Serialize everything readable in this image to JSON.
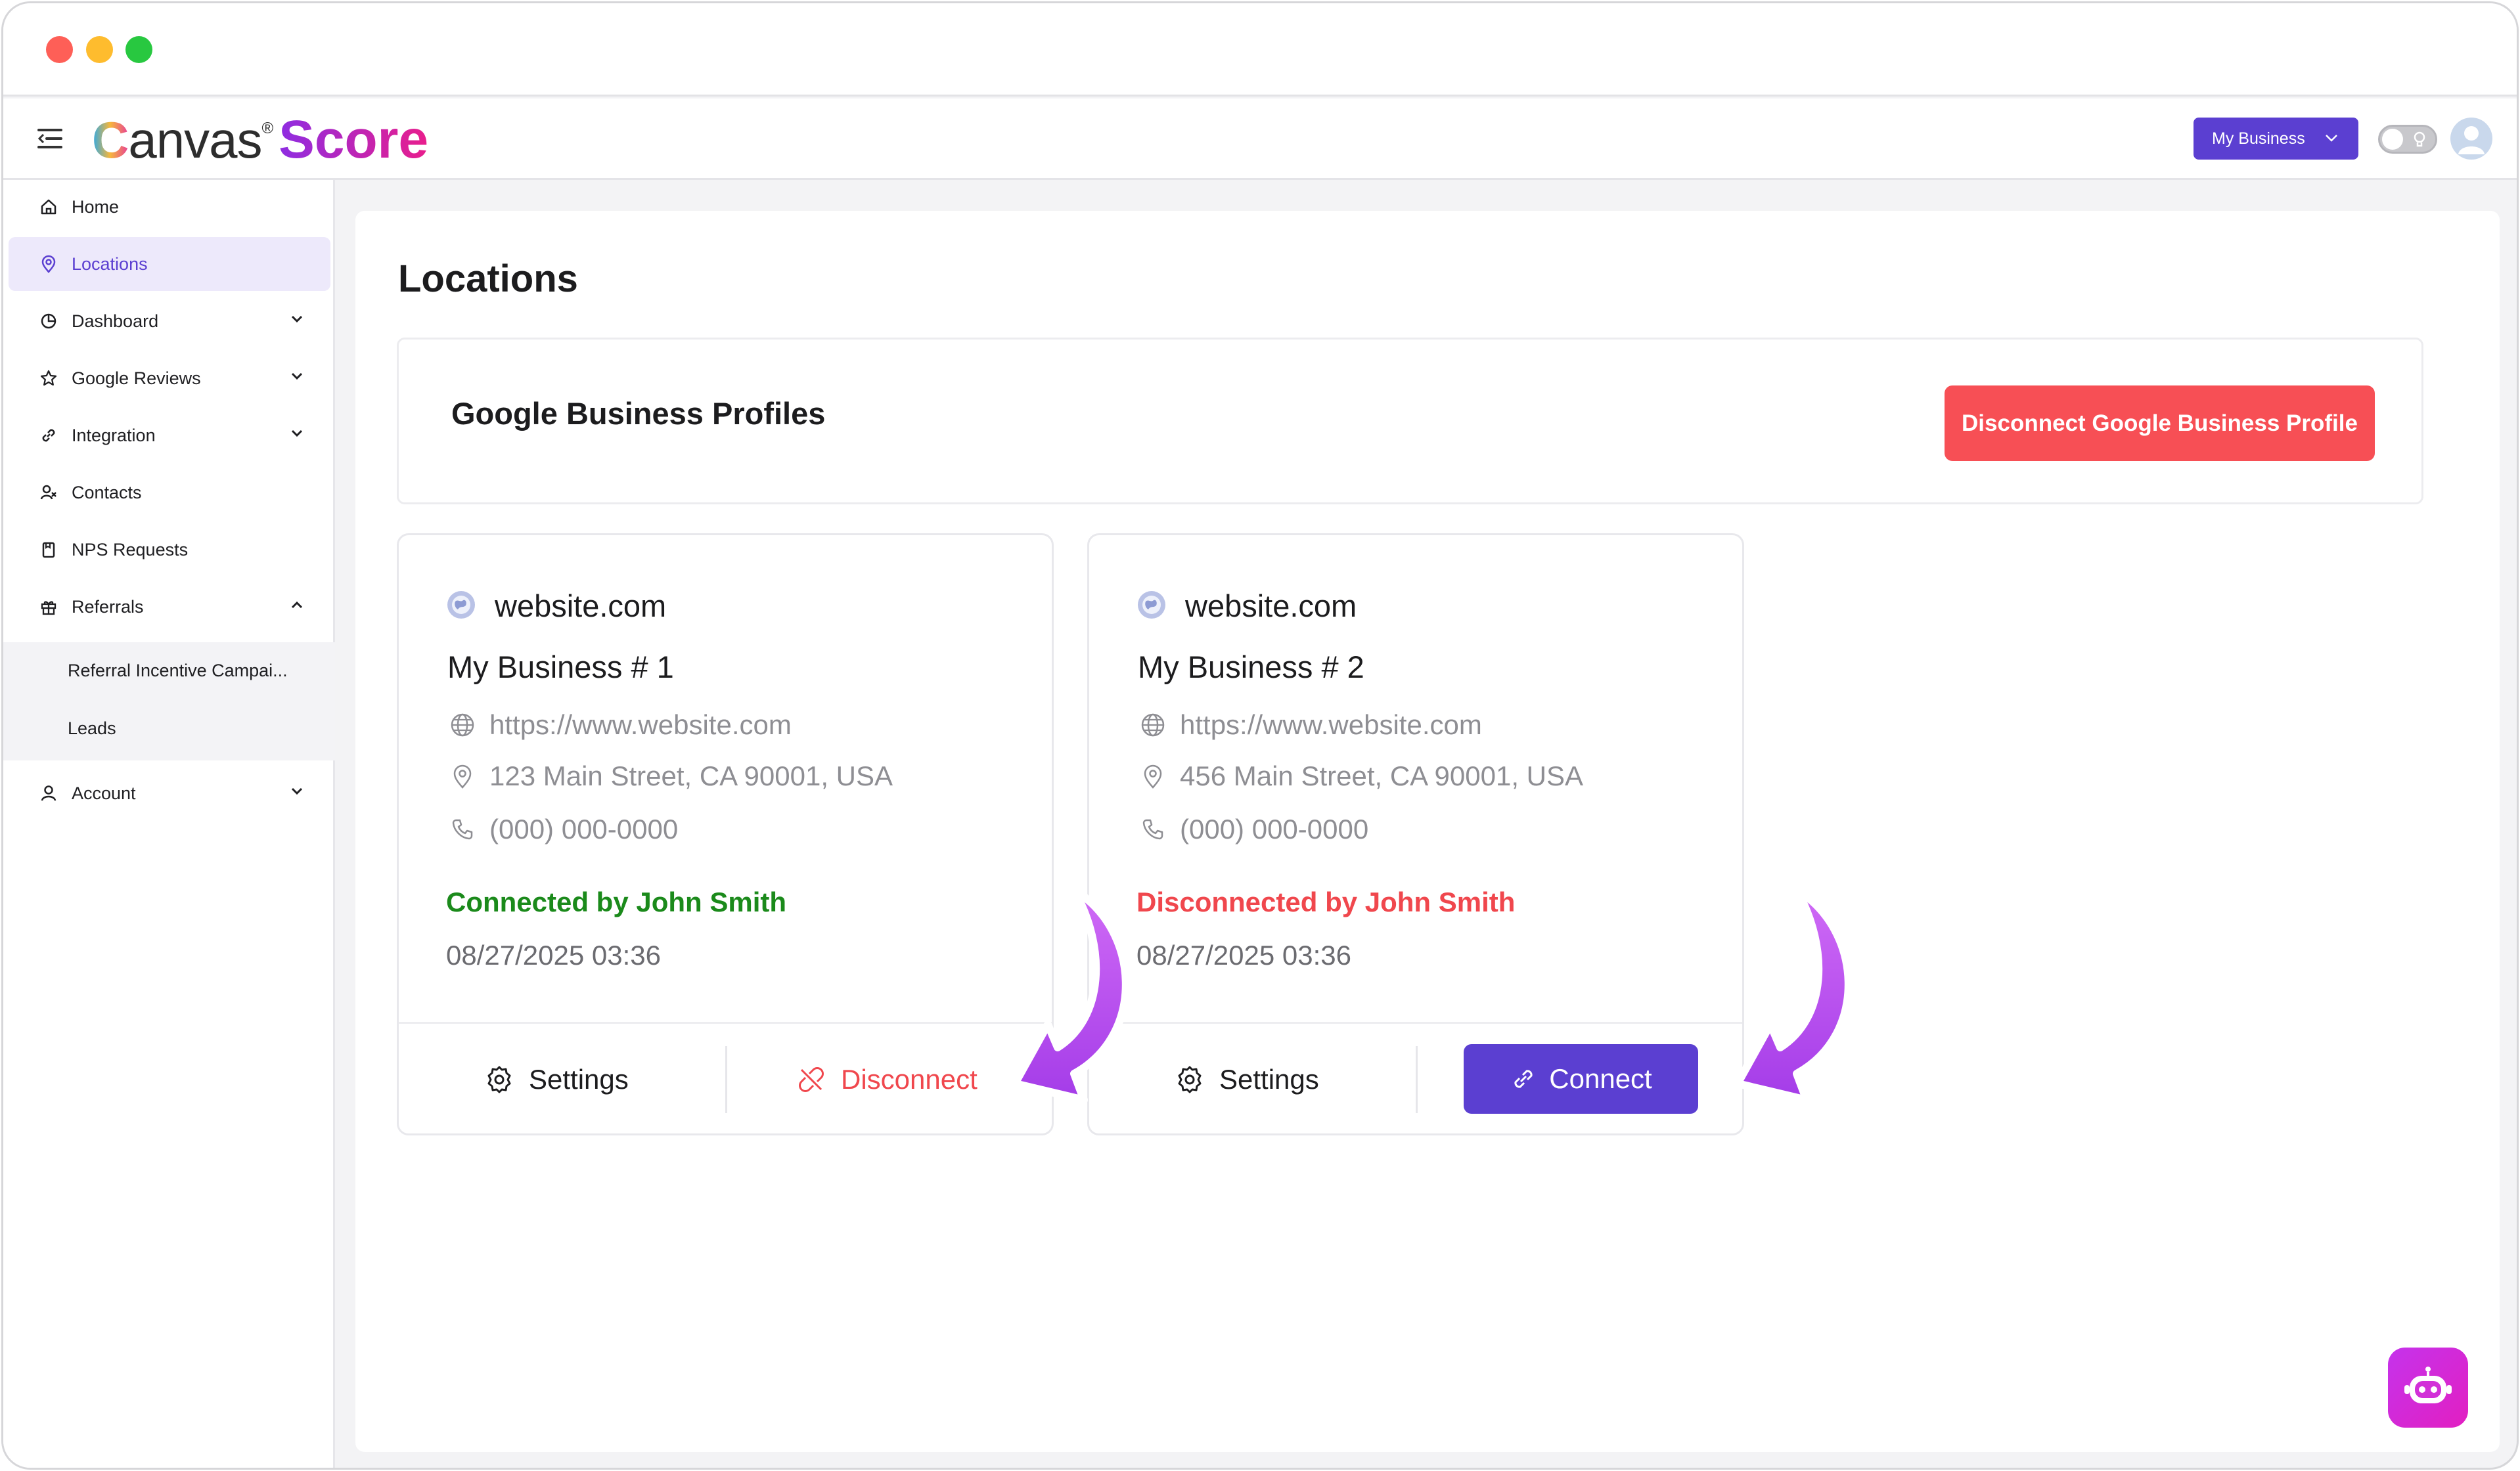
{
  "header": {
    "logo_canvas_c": "C",
    "logo_canvas_rest": "anvas",
    "logo_reg": "®",
    "logo_score": "Score",
    "business_select": "My Business"
  },
  "sidebar": {
    "items": [
      {
        "label": "Home",
        "icon": "home-icon"
      },
      {
        "label": "Locations",
        "icon": "map-pin-icon",
        "active": true
      },
      {
        "label": "Dashboard",
        "icon": "pie-chart-icon"
      },
      {
        "label": "Google Reviews",
        "icon": "star-icon"
      },
      {
        "label": "Integration",
        "icon": "link-icon"
      },
      {
        "label": "Contacts",
        "icon": "contacts-icon"
      },
      {
        "label": "NPS Requests",
        "icon": "clipboard-icon"
      },
      {
        "label": "Referrals",
        "icon": "gift-icon"
      },
      {
        "label": "Account",
        "icon": "user-icon"
      }
    ],
    "referrals_sub": [
      "Referral Incentive Campai...",
      "Leads"
    ]
  },
  "main": {
    "title": "Locations",
    "gbp_title": "Google Business Profiles",
    "disconnect_all_label": "Disconnect Google Business Profile",
    "cards": [
      {
        "site": "website.com",
        "name": "My Business # 1",
        "url": "https://www.website.com",
        "address": "123 Main Street, CA 90001, USA",
        "phone": "(000) 000-0000",
        "status": "Connected by John Smith",
        "date": "08/27/2025 03:36",
        "settings_label": "Settings",
        "action_label": "Disconnect"
      },
      {
        "site": "website.com",
        "name": "My Business # 2",
        "url": "https://www.website.com",
        "address": "456 Main Street, CA 90001, USA",
        "phone": "(000) 000-0000",
        "status": "Disconnected by John Smith",
        "date": "08/27/2025 03:36",
        "settings_label": "Settings",
        "action_label": "Connect"
      }
    ]
  },
  "colors": {
    "accent": "#5b3fd1",
    "danger": "#f74f55",
    "success": "#1b8a1b",
    "arrow": "#b83cf0"
  }
}
